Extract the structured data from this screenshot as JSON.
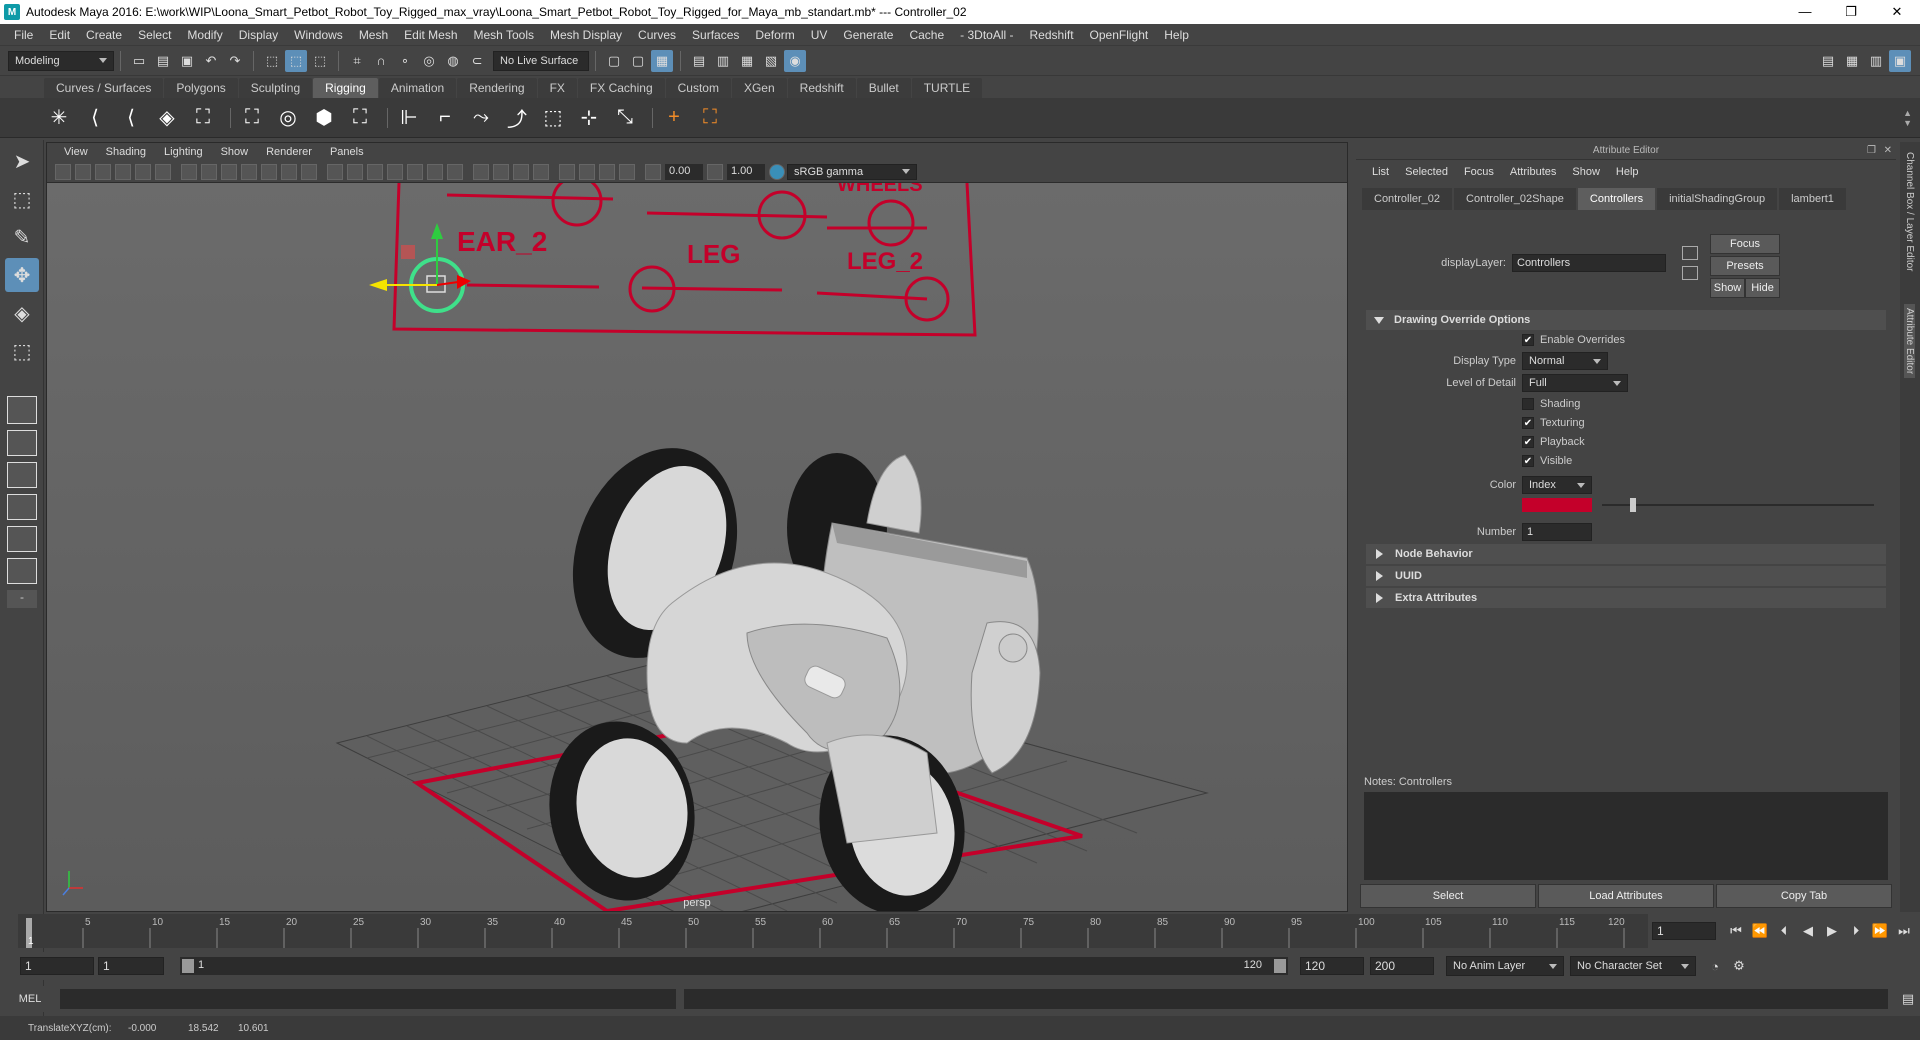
{
  "window": {
    "title": "Autodesk Maya 2016: E:\\work\\WIP\\Loona_Smart_Petbot_Robot_Toy_Rigged_max_vray\\Loona_Smart_Petbot_Robot_Toy_Rigged_for_Maya_mb_standart.mb*   ---   Controller_02",
    "minimize": "—",
    "maximize": "❐",
    "close": "✕"
  },
  "menubar": [
    "File",
    "Edit",
    "Create",
    "Select",
    "Modify",
    "Display",
    "Windows",
    "Mesh",
    "Edit Mesh",
    "Mesh Tools",
    "Mesh Display",
    "Curves",
    "Surfaces",
    "Deform",
    "UV",
    "Generate",
    "Cache",
    "- 3DtoAll -",
    "Redshift",
    "OpenFlight",
    "Help"
  ],
  "statusline": {
    "mode": "Modeling",
    "live_surface": "No Live Surface"
  },
  "shelf_tabs": [
    {
      "label": "Curves / Surfaces"
    },
    {
      "label": "Polygons"
    },
    {
      "label": "Sculpting"
    },
    {
      "label": "Rigging",
      "active": true
    },
    {
      "label": "Animation"
    },
    {
      "label": "Rendering"
    },
    {
      "label": "FX"
    },
    {
      "label": "FX Caching"
    },
    {
      "label": "Custom"
    },
    {
      "label": "XGen"
    },
    {
      "label": "Redshift"
    },
    {
      "label": "Bullet"
    },
    {
      "label": "TURTLE"
    }
  ],
  "viewport": {
    "menu": [
      "View",
      "Shading",
      "Lighting",
      "Show",
      "Renderer",
      "Panels"
    ],
    "exposure": "0.00",
    "gamma": "1.00",
    "color_space": "sRGB gamma",
    "camera_label": "persp",
    "controller_labels": [
      "EAR_2",
      "LEG",
      "LEG_2",
      "WHEELS"
    ]
  },
  "attribute_editor": {
    "title": "Attribute Editor",
    "menu": [
      "List",
      "Selected",
      "Focus",
      "Attributes",
      "Show",
      "Help"
    ],
    "tabs": [
      {
        "label": "Controller_02"
      },
      {
        "label": "Controller_02Shape"
      },
      {
        "label": "Controllers",
        "active": true
      },
      {
        "label": "initialShadingGroup"
      },
      {
        "label": "lambert1"
      }
    ],
    "display_layer_label": "displayLayer:",
    "display_layer_value": "Controllers",
    "buttons": {
      "focus": "Focus",
      "presets": "Presets",
      "show": "Show",
      "hide": "Hide"
    },
    "section_drawing": "Drawing Override Options",
    "enable_overrides": "Enable Overrides",
    "display_type_label": "Display Type",
    "display_type_value": "Normal",
    "lod_label": "Level of Detail",
    "lod_value": "Full",
    "shading": "Shading",
    "texturing": "Texturing",
    "playback": "Playback",
    "visible": "Visible",
    "color_label": "Color",
    "color_value": "Index",
    "swatch_color": "#c4002a",
    "number_label": "Number",
    "number_value": "1",
    "section_node": "Node Behavior",
    "section_uuid": "UUID",
    "section_extra": "Extra Attributes",
    "notes_label": "Notes:  Controllers",
    "bottom_buttons": {
      "select": "Select",
      "load": "Load Attributes",
      "copy": "Copy Tab"
    }
  },
  "side_strip": {
    "channel_box": "Channel Box / Layer Editor",
    "attr_editor": "Attribute Editor"
  },
  "timeslider": {
    "ticks": [
      "1",
      "5",
      "10",
      "15",
      "20",
      "25",
      "30",
      "35",
      "40",
      "45",
      "50",
      "55",
      "60",
      "65",
      "70",
      "75",
      "80",
      "85",
      "90",
      "95",
      "100",
      "105",
      "110",
      "115",
      "120"
    ],
    "current_frame": "1"
  },
  "range": {
    "start": "1",
    "start2": "1",
    "slider_start": "1",
    "slider_end": "120",
    "end": "120",
    "end2": "200",
    "anim_layer": "No Anim Layer",
    "char_set": "No Character Set"
  },
  "cmdline": {
    "mel": "MEL"
  },
  "helpline": {
    "label": "TranslateXYZ(cm):",
    "x": "-0.000",
    "y": "18.542",
    "z": "10.601"
  }
}
